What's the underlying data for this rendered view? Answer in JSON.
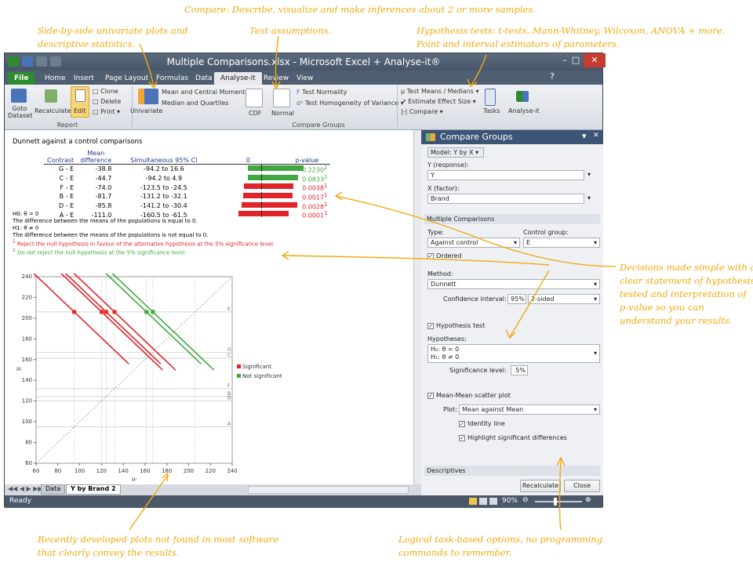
{
  "annotations": {
    "top": "Compare: Describe, visualize and make inferences about 2 or more samples.",
    "sidebyside_1": "Side-by-side univariate plots and",
    "sidebyside_2": "descriptive statistics.",
    "assumptions": "Test assumptions.",
    "hypothesis_1": "Hypothesis tests: t-tests, Mann-Whitney, Wilcoxon, ANOVA + more.",
    "hypothesis_2": "Point and interval estimators of parameters.",
    "decisions_1": "Decisions made simple with a",
    "decisions_2": "clear statement of hypothesis",
    "decisions_3": "tested and interpretation of",
    "decisions_4": "p-value so you can",
    "decisions_5": "understand your results.",
    "plots_1": "Recently developed plots not found in most software",
    "plots_2": "that clearly convey the results.",
    "logical_1": "Logical task-based options, no programming",
    "logical_2": "commands to remember."
  },
  "window": {
    "title": "Multiple Comparisons.xlsx - Microsoft Excel + Analyse-it®"
  },
  "tabs": [
    "File",
    "Home",
    "Insert",
    "Page Layout",
    "Formulas",
    "Data",
    "Analyse-it",
    "Review",
    "View"
  ],
  "ribbon": {
    "goto": "Goto",
    "dataset": "Dataset",
    "recalculate": "Recalculate",
    "edit": "Edit",
    "clone": "Clone",
    "delete": "Delete",
    "print": "Print",
    "report_group": "Report",
    "univariate": "Univariate",
    "mean_central": "Mean and Central Moments",
    "median_quart": "Median and Quartiles",
    "cdf": "CDF",
    "normal": "Normal",
    "test_normality": "Test Normality",
    "test_homog": "Test Homogeneity of Variance",
    "test_means": "Test Means / Medians",
    "estimate_effect": "Estimate Effect Size",
    "compare": "Compare",
    "compare_group": "Compare Groups",
    "tasks": "Tasks",
    "analyseit": "Analyse-it"
  },
  "report": {
    "title": "Dunnett against a control comparisons",
    "headers": {
      "mean1": "Mean",
      "contrast": "Contrast",
      "mean2": "difference",
      "ci": "Simultaneous 95% CI",
      "zero": "0",
      "p": "p-value"
    },
    "rows": [
      {
        "contrast": "G - E",
        "diff": "-38.8",
        "lo": "-94.2",
        "hi": "16.6",
        "p": "0.2230",
        "sig": false
      },
      {
        "contrast": "C - E",
        "diff": "-44.7",
        "lo": "-94.2",
        "hi": "4.9",
        "p": "0.0833",
        "sig": false
      },
      {
        "contrast": "F - E",
        "diff": "-74.0",
        "lo": "-123.5",
        "hi": "-24.5",
        "p": "0.0038",
        "sig": true
      },
      {
        "contrast": "B - E",
        "diff": "-81.7",
        "lo": "-131.2",
        "hi": "-32.1",
        "p": "0.0017",
        "sig": true
      },
      {
        "contrast": "D - E",
        "diff": "-85.8",
        "lo": "-141.2",
        "hi": "-30.4",
        "p": "0.0028",
        "sig": true
      },
      {
        "contrast": "A - E",
        "diff": "-111.0",
        "lo": "-160.5",
        "hi": "-61.5",
        "p": "0.0001",
        "sig": true
      }
    ],
    "to": "to",
    "h0": "H0: θ = 0",
    "h0_text": "The difference between the means of the populations is equal to 0.",
    "h1": "H1: θ ≠ 0",
    "h1_text": "The difference between the means of the populations is not equal to 0.",
    "note1": "Reject the null hypothesis in favour of the alternative hypothesis at the 5% significance level.",
    "note2": "Do not reject the null hypothesis at the 5% significance level.",
    "sig_color": "#e0242a",
    "nonsig_color": "#3fa83f"
  },
  "chart_data": {
    "type": "line",
    "xlabel": "μᵢ",
    "ylabel": "μⱼ",
    "xlim": [
      60,
      240
    ],
    "ylim": [
      60,
      240
    ],
    "xticks": [
      60,
      80,
      100,
      120,
      140,
      160,
      180,
      200,
      220,
      240
    ],
    "yticks": [
      60,
      80,
      100,
      120,
      140,
      160,
      180,
      200,
      220,
      240
    ],
    "reference_lines": [
      {
        "label": "E",
        "value": 206.0
      },
      {
        "label": "G",
        "value": 167.2
      },
      {
        "label": "C",
        "value": 161.3
      },
      {
        "label": "F",
        "value": 132.0
      },
      {
        "label": "B",
        "value": 124.3
      },
      {
        "label": "D",
        "value": 120.2
      },
      {
        "label": "A",
        "value": 95.0
      }
    ],
    "series": [
      {
        "name": "Significant",
        "color": "#e0242a",
        "points": [
          {
            "x": 95.0,
            "y": 206.0
          },
          {
            "x": 120.2,
            "y": 206.0
          },
          {
            "x": 124.3,
            "y": 206.0
          },
          {
            "x": 132.0,
            "y": 206.0
          }
        ]
      },
      {
        "name": "Not significant",
        "color": "#3fa83f",
        "points": [
          {
            "x": 161.3,
            "y": 206.0
          },
          {
            "x": 167.2,
            "y": 206.0
          }
        ]
      }
    ]
  },
  "panel": {
    "title": "Compare Groups",
    "model": "Model: Y by X",
    "y_label": "Y (response):",
    "y_value": "Y",
    "x_label": "X (factor):",
    "x_value": "Brand",
    "mc_section": "Multiple Comparisons",
    "type_label": "Type:",
    "type_value": "Against control",
    "control_label": "Control group:",
    "control_value": "E",
    "ordered": "Ordered",
    "method_label": "Method:",
    "method_value": "Dunnett",
    "ci_label": "Confidence interval:",
    "ci_value": "95%",
    "ci_sided": "2-sided",
    "hyp_test": "Hypothesis test",
    "hyp_label": "Hypotheses:",
    "h0": "H₀: θ = 0",
    "h1": "H₁: θ ≠ 0",
    "sig_label": "Significance level:",
    "sig_value": "5%",
    "scatter": "Mean-Mean scatter plot",
    "plot_label": "Plot:",
    "plot_value": "Mean against Mean",
    "identity": "Identity line",
    "highlight": "Highlight significant differences",
    "descriptives": "Descriptives",
    "recalc_btn": "Recalculate",
    "close_btn": "Close"
  },
  "sheets": {
    "data": "Data",
    "active": "Y by Brand 2"
  },
  "status": {
    "ready": "Ready",
    "zoom": "90%"
  }
}
